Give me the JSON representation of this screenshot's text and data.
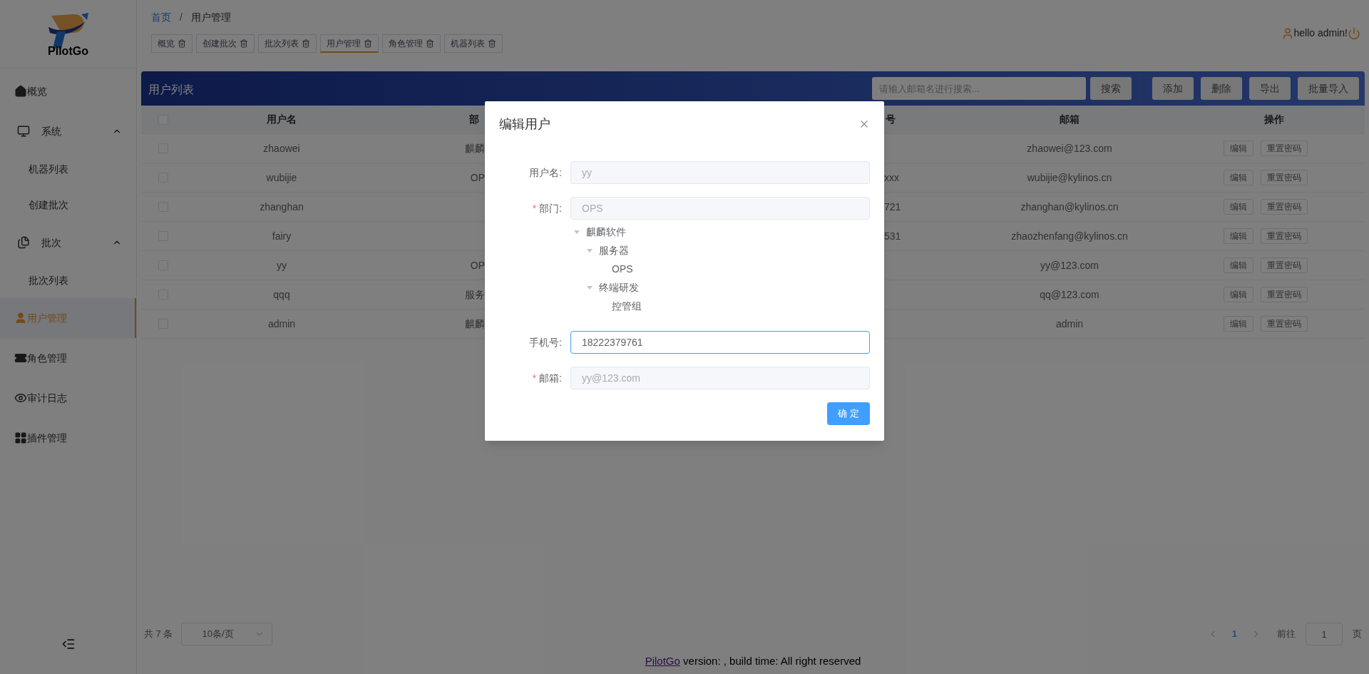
{
  "logo": {
    "text": "PilotGo"
  },
  "sidebar": {
    "items": [
      {
        "label": "概览",
        "selected": false
      },
      {
        "label": "系统",
        "selected": false,
        "expanded": true,
        "children": [
          {
            "label": "机器列表",
            "selected": false
          },
          {
            "label": "创建批次",
            "selected": false
          }
        ]
      },
      {
        "label": "批次",
        "selected": false,
        "expanded": true,
        "children": [
          {
            "label": "批次列表",
            "selected": false
          }
        ]
      },
      {
        "label": "用户管理",
        "selected": true
      },
      {
        "label": "角色管理",
        "selected": false
      },
      {
        "label": "审计日志",
        "selected": false
      },
      {
        "label": "插件管理",
        "selected": false
      }
    ]
  },
  "breadcrumb": {
    "items": [
      "首页",
      "用户管理"
    ],
    "separator": "/"
  },
  "tags": [
    {
      "label": "概览",
      "selected": false
    },
    {
      "label": "创建批次",
      "selected": false
    },
    {
      "label": "批次列表",
      "selected": false
    },
    {
      "label": "用户管理",
      "selected": true
    },
    {
      "label": "角色管理",
      "selected": false
    },
    {
      "label": "机器列表",
      "selected": false
    }
  ],
  "user": {
    "greeting": "hello admin!"
  },
  "panel": {
    "title": "用户列表",
    "search": {
      "placeholder": "请输入邮箱名进行搜索..."
    },
    "search_button": "搜索",
    "buttons": [
      "添加",
      "删除",
      "导出",
      "批量导入"
    ]
  },
  "table": {
    "header_checked": false,
    "columns": [
      "用户名",
      "部",
      "号",
      "邮箱",
      "操作"
    ],
    "rows": [
      {
        "checked": false,
        "username": "zhaowei",
        "dept": "麒麟",
        "phone": "",
        "email": "zhaowei@123.com",
        "actions": [
          "编辑",
          "重置密码"
        ]
      },
      {
        "checked": false,
        "username": "wubijie",
        "dept": "OP",
        "phone": "xxx",
        "email": "wubijie@kylinos.cn",
        "actions": [
          "编辑",
          "重置密码"
        ]
      },
      {
        "checked": false,
        "username": "zhanghan",
        "dept": "",
        "phone": "721",
        "email": "zhanghan@kylinos.cn",
        "actions": [
          "编辑",
          "重置密码"
        ]
      },
      {
        "checked": false,
        "username": "fairy",
        "dept": "",
        "phone": "531",
        "email": "zhaozhenfang@kylinos.cn",
        "actions": [
          "编辑",
          "重置密码"
        ]
      },
      {
        "checked": false,
        "username": "yy",
        "dept": "OP",
        "phone": "",
        "email": "yy@123.com",
        "actions": [
          "编辑",
          "重置密码"
        ]
      },
      {
        "checked": false,
        "username": "qqq",
        "dept": "服务",
        "phone": "",
        "email": "qq@123.com",
        "actions": [
          "编辑",
          "重置密码"
        ]
      },
      {
        "checked": false,
        "username": "admin",
        "dept": "麒麟",
        "phone": "",
        "email": "admin",
        "actions": [
          "编辑",
          "重置密码"
        ]
      }
    ]
  },
  "pagination": {
    "total": "共 7 条",
    "page_size": "10条/页",
    "pages": [
      {
        "label": "1",
        "selected": true
      }
    ],
    "goto_label": "前往",
    "goto_value": "1",
    "goto_suffix": "页"
  },
  "footer": {
    "link": "PilotGo",
    "text": " version: , build time: All right reserved"
  },
  "dialog": {
    "title": "编辑用户",
    "confirm": "确 定",
    "required_mark": "*",
    "fields": [
      {
        "label": "用户名:",
        "required": false,
        "value": "yy",
        "disabled": true,
        "focused": false
      },
      {
        "label": "部门:",
        "required": true,
        "value": "OPS",
        "disabled": true,
        "focused": false,
        "tree": [
          {
            "label": "麒麟软件",
            "expanded": true,
            "children": [
              {
                "label": "服务器",
                "expanded": true,
                "children": [
                  {
                    "label": "OPS"
                  }
                ]
              },
              {
                "label": "终端研发",
                "expanded": true,
                "children": [
                  {
                    "label": "控管组"
                  }
                ]
              }
            ]
          }
        ]
      },
      {
        "label": "手机号:",
        "required": false,
        "value": "18222379761",
        "disabled": false,
        "focused": true
      },
      {
        "label": "邮箱:",
        "required": true,
        "value": "yy@123.com",
        "disabled": true,
        "focused": false
      }
    ]
  }
}
